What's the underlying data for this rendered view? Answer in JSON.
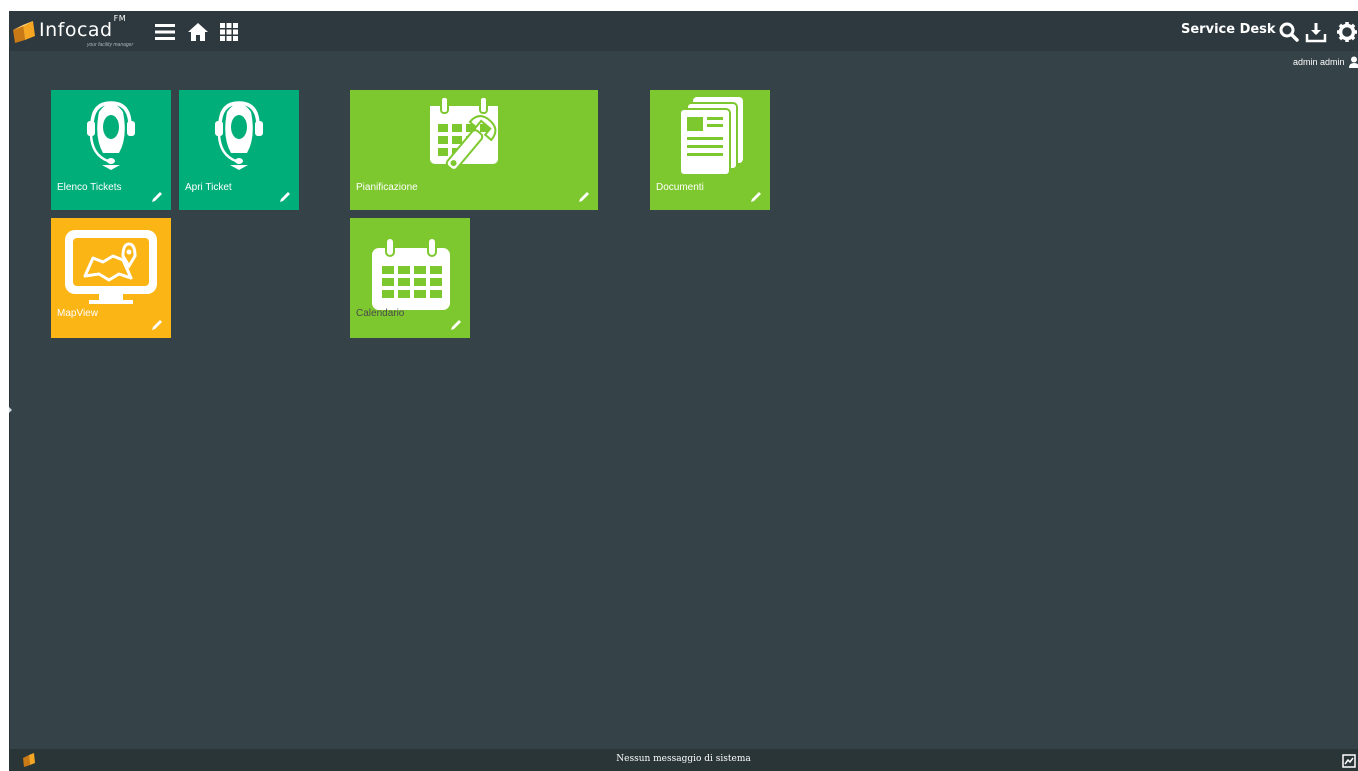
{
  "header": {
    "brand": "Infocad",
    "brand_sup": "FM",
    "tagline": "your facility manager",
    "module_title": "Service Desk",
    "user_name": "admin admin",
    "icons": [
      "menu-icon",
      "home-icon",
      "grid-icon",
      "search-icon",
      "download-icon",
      "gear-icon",
      "user-icon"
    ]
  },
  "tiles": [
    {
      "label": "Elenco Tickets",
      "icon": "headset-agent-icon",
      "color": "#00ae7a"
    },
    {
      "label": "Apri Ticket",
      "icon": "headset-agent-icon",
      "color": "#00ae7a"
    },
    {
      "label": "Pianificazione",
      "icon": "calendar-wrench-icon",
      "color": "#7ec82f"
    },
    {
      "label": "Documenti",
      "icon": "documents-icon",
      "color": "#7ec82f"
    },
    {
      "label": "MapView",
      "icon": "map-monitor-icon",
      "color": "#fbb515"
    },
    {
      "label": "Calendario",
      "icon": "calendar-icon",
      "color": "#7ec82f"
    }
  ],
  "status": {
    "message": "Nessun messaggio di sistema"
  },
  "colors": {
    "background": "#354349",
    "topbar": "#2d393e",
    "teal": "#00ae7a",
    "green": "#7ec82f",
    "amber": "#fbb515"
  }
}
